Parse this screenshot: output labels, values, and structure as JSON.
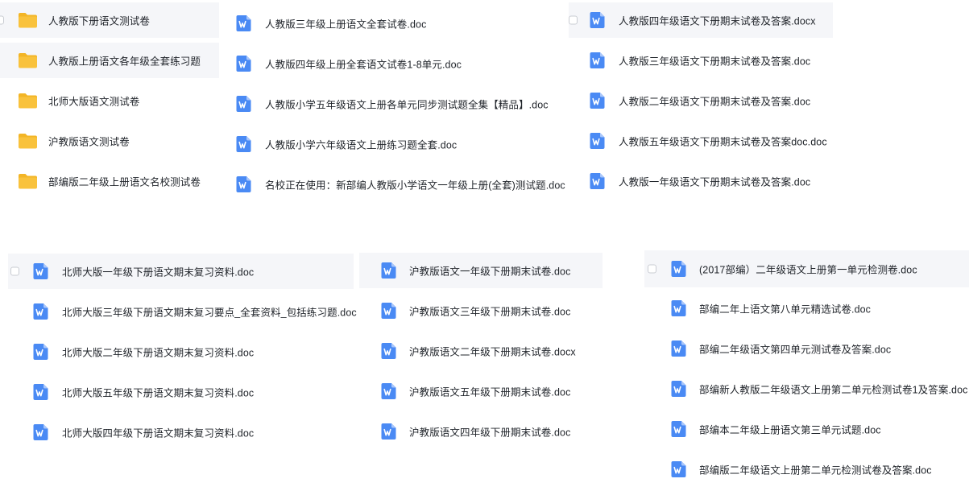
{
  "panels": [
    {
      "id": "p1",
      "items": [
        {
          "type": "folder",
          "name": "人教版下册语文测试卷",
          "highlight": true,
          "checkbox": true
        },
        {
          "type": "folder",
          "name": "人教版上册语文各年级全套练习题",
          "highlight": true,
          "checkbox": false
        },
        {
          "type": "folder",
          "name": "北师大版语文测试卷",
          "highlight": false,
          "checkbox": false
        },
        {
          "type": "folder",
          "name": "沪教版语文测试卷",
          "highlight": false,
          "checkbox": false
        },
        {
          "type": "folder",
          "name": "部编版二年级上册语文名校测试卷",
          "highlight": false,
          "checkbox": false
        }
      ]
    },
    {
      "id": "p2",
      "items": [
        {
          "type": "doc",
          "name": "人教版三年级上册语文全套试卷.doc",
          "highlight": false,
          "checkbox": false
        },
        {
          "type": "doc",
          "name": "人教版四年级上册全套语文试卷1-8单元.doc",
          "highlight": false,
          "checkbox": false
        },
        {
          "type": "doc",
          "name": "人教版小学五年级语文上册各单元同步测试题全集【精品】.doc",
          "highlight": false,
          "checkbox": false
        },
        {
          "type": "doc",
          "name": "人教版小学六年级语文上册练习题全套.doc",
          "highlight": false,
          "checkbox": false
        },
        {
          "type": "doc",
          "name": "名校正在使用：新部编人教版小学语文一年级上册(全套)测试题.doc",
          "highlight": false,
          "checkbox": false
        }
      ]
    },
    {
      "id": "p3",
      "items": [
        {
          "type": "doc",
          "name": "人教版四年级语文下册期末试卷及答案.docx",
          "highlight": true,
          "checkbox": true
        },
        {
          "type": "doc",
          "name": "人教版三年级语文下册期末试卷及答案.doc",
          "highlight": false,
          "checkbox": false
        },
        {
          "type": "doc",
          "name": "人教版二年级语文下册期末试卷及答案.doc",
          "highlight": false,
          "checkbox": false
        },
        {
          "type": "doc",
          "name": "人教版五年级语文下册期末试卷及答案doc.doc",
          "highlight": false,
          "checkbox": false
        },
        {
          "type": "doc",
          "name": "人教版一年级语文下册期末试卷及答案.doc",
          "highlight": false,
          "checkbox": false
        }
      ]
    },
    {
      "id": "p4",
      "items": [
        {
          "type": "doc",
          "name": "北师大版一年级下册语文期末复习资料.doc",
          "highlight": true,
          "checkbox": true
        },
        {
          "type": "doc",
          "name": "北师大版三年级下册语文期末复习要点_全套资料_包括练习题.doc",
          "highlight": false,
          "checkbox": false
        },
        {
          "type": "doc",
          "name": "北师大版二年级下册语文期末复习资料.doc",
          "highlight": false,
          "checkbox": false
        },
        {
          "type": "doc",
          "name": "北师大版五年级下册语文期末复习资料.doc",
          "highlight": false,
          "checkbox": false
        },
        {
          "type": "doc",
          "name": "北师大版四年级下册语文期末复习资料.doc",
          "highlight": false,
          "checkbox": false
        }
      ]
    },
    {
      "id": "p5",
      "items": [
        {
          "type": "doc",
          "name": "沪教版语文一年级下册期末试卷.doc",
          "highlight": true,
          "checkbox": false
        },
        {
          "type": "doc",
          "name": "沪教版语文三年级下册期末试卷.doc",
          "highlight": false,
          "checkbox": false
        },
        {
          "type": "doc",
          "name": "沪教版语文二年级下册期末试卷.docx",
          "highlight": false,
          "checkbox": false
        },
        {
          "type": "doc",
          "name": "沪教版语文五年级下册期末试卷.doc",
          "highlight": false,
          "checkbox": false
        },
        {
          "type": "doc",
          "name": "沪教版语文四年级下册期末试卷.doc",
          "highlight": false,
          "checkbox": false
        }
      ]
    },
    {
      "id": "p6",
      "items": [
        {
          "type": "doc",
          "name": "(2017部编）二年级语文上册第一单元检测卷.doc",
          "highlight": true,
          "checkbox": true
        },
        {
          "type": "doc",
          "name": "部编二年上语文第八单元精选试卷.doc",
          "highlight": false,
          "checkbox": false
        },
        {
          "type": "doc",
          "name": "部编二年级语文第四单元测试卷及答案.doc",
          "highlight": false,
          "checkbox": false
        },
        {
          "type": "doc",
          "name": "部编新人教版二年级语文上册第二单元检测试卷1及答案.doc",
          "highlight": false,
          "checkbox": false
        },
        {
          "type": "doc",
          "name": "部编本二年级上册语文第三单元试题.doc",
          "highlight": false,
          "checkbox": false
        },
        {
          "type": "doc",
          "name": "部编版二年级语文上册第二单元检测试卷及答案.doc",
          "highlight": false,
          "checkbox": false
        }
      ]
    }
  ],
  "colors": {
    "folder": "#f9c23c",
    "folder_tab": "#f3b526",
    "doc": "#4a8af4",
    "doc_fold": "#a8c6fb",
    "highlight": "#f5f6f9"
  },
  "icons": {
    "folder": "folder-icon",
    "doc": "word-doc-icon"
  }
}
